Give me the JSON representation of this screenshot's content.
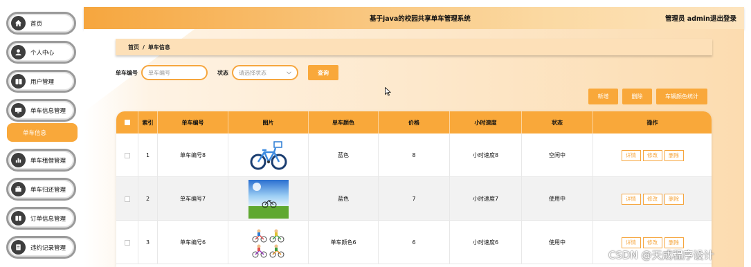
{
  "sidebar": {
    "items": [
      {
        "label": "首页",
        "icon": "home-icon"
      },
      {
        "label": "个人中心",
        "icon": "user-icon"
      },
      {
        "label": "用户管理",
        "icon": "users-icon"
      },
      {
        "label": "单车信息管理",
        "icon": "monitor-icon"
      },
      {
        "label": "单车租借管理",
        "icon": "chart-icon"
      },
      {
        "label": "单车归还管理",
        "icon": "briefcase-icon"
      },
      {
        "label": "订单信息管理",
        "icon": "grid-icon"
      },
      {
        "label": "违约记录管理",
        "icon": "document-icon"
      }
    ],
    "active_sub": "单车信息"
  },
  "header": {
    "title": "基于java的校园共享单车管理系统",
    "admin": "管理员 admin",
    "logout": "退出登录"
  },
  "breadcrumb": {
    "home": "首页",
    "sep": "/",
    "current": "单车信息"
  },
  "search": {
    "bike_no_label": "单车编号",
    "bike_no_placeholder": "单车编号",
    "status_label": "状态",
    "status_placeholder": "请选择状态",
    "query_button": "查询"
  },
  "actions": {
    "add": "新增",
    "delete": "删除",
    "stats": "车辆颜色统计"
  },
  "table": {
    "headers": [
      "索引",
      "单车编号",
      "图片",
      "单车颜色",
      "价格",
      "小时速度",
      "状态",
      "操作"
    ],
    "rows": [
      {
        "index": "1",
        "bike_no": "单车编号8",
        "image": "bicycle-image",
        "color": "蓝色",
        "price": "8",
        "speed": "小时速度8",
        "status": "空闲中"
      },
      {
        "index": "2",
        "bike_no": "单车编号7",
        "image": "bicycle-landscape-image",
        "color": "蓝色",
        "price": "7",
        "speed": "小时速度7",
        "status": "使用中"
      },
      {
        "index": "3",
        "bike_no": "单车编号6",
        "image": "cyclists-image",
        "color": "单车颜色6",
        "price": "6",
        "speed": "小时速度6",
        "status": "使用中"
      }
    ],
    "row_actions": {
      "detail": "详情",
      "edit": "修改",
      "delete": "删除"
    }
  },
  "watermark": "CSDN @天成程序设计",
  "colors": {
    "accent": "#f9a83a",
    "header_start": "#f6a63e",
    "header_end": "#fde4bf"
  }
}
